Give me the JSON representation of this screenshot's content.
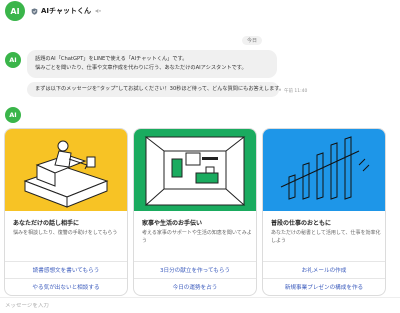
{
  "header": {
    "avatar_text": "AI",
    "title": "AIチャットくん",
    "mute_icon": "speaker-muted-icon"
  },
  "date_label": "今日",
  "bot": {
    "avatar_text": "AI"
  },
  "messages": [
    {
      "line1": "話題のAI「ChatGPT」をLINEで使える「AIチャットくん」です。",
      "line2": "悩みごとを聞いたり、仕事や文章作成を代わりに行う、あなただけのAIアシスタントです。"
    },
    {
      "text": "まずは以下のメッセージを“タップ”してお試しください！30秒ほど待って、どんな質問にもお答えします。",
      "time": "午前 11:40"
    }
  ],
  "cards": [
    {
      "title": "あなただけの話し相手に",
      "desc": "悩みを相談したり、復讐の手助けをしてもらう",
      "bg_color": "#f7c325",
      "actions": [
        "読書感想文を書いてもらう",
        "やる気が出ないと相談する"
      ]
    },
    {
      "title": "家事や生活のお手伝い",
      "desc": "考える家事のサポートや生活の知恵を聞いてみよう",
      "bg_color": "#1aab5f",
      "actions": [
        "3日分の献立を作ってもらう",
        "今日の運勢を占う"
      ]
    },
    {
      "title": "普段の仕事のおともに",
      "desc": "あなただけの秘書として活用して、仕事を効率化しよう",
      "bg_color": "#1e96e8",
      "actions": [
        "お礼メールの作成",
        "新規事業プレゼンの構成を作る"
      ]
    }
  ],
  "input": {
    "placeholder": "メッセージを入力"
  }
}
